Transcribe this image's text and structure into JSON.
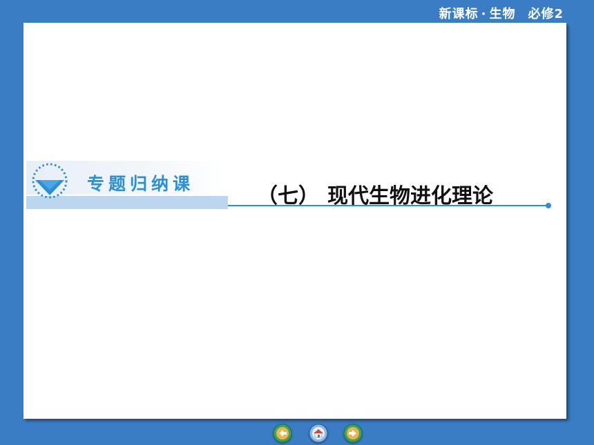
{
  "header": {
    "course": "新课标",
    "separator": "·",
    "subject": "生物",
    "edition": "必修2"
  },
  "banner": {
    "label": "专题归纳课",
    "icon": "chevron-down-circle-icon"
  },
  "title": {
    "number": "（七）",
    "text": "现代生物进化理论"
  },
  "nav": {
    "prev_icon": "previous-page-icon",
    "home_icon": "home-icon",
    "next_icon": "next-page-icon"
  },
  "colors": {
    "background": "#3a7dc4",
    "accent": "#2b8fd6",
    "banner_strip": "#bcd6ef",
    "slide": "#ffffff"
  }
}
